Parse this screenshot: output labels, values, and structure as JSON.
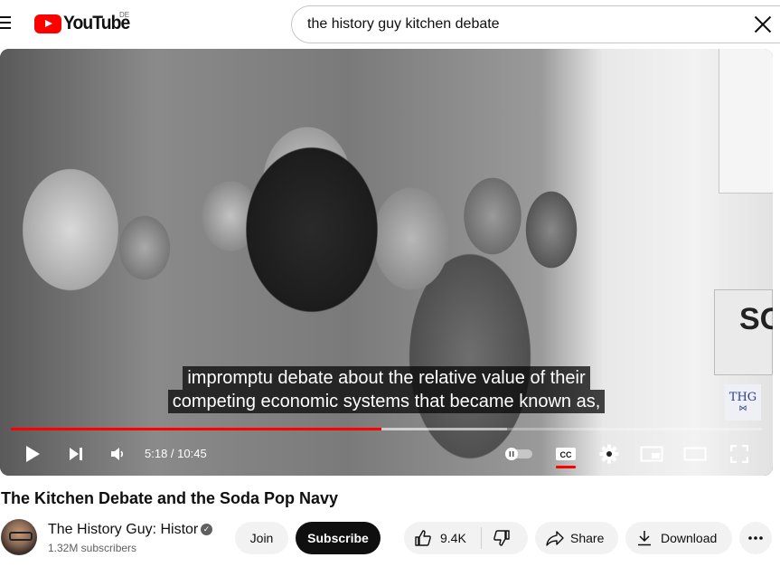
{
  "header": {
    "logo_text": "YouTube",
    "country_code": "DE",
    "search_value": "the history guy kitchen debate"
  },
  "player": {
    "caption_lines": [
      "impromptu debate about the relative value of their",
      "competing economic systems that became known as,"
    ],
    "watermark": "THG",
    "scene_text": "SO",
    "time_current": "5:18",
    "time_separator": " / ",
    "time_total": "10:45",
    "progress_played_fraction": 0.493,
    "progress_buffered_fraction": 0.661,
    "cc_enabled": true,
    "accent_color": "#ff0000"
  },
  "video": {
    "title": "The Kitchen Debate and the Soda Pop Navy",
    "channel_name": "The History Guy: Histor",
    "subscribers": "1.32M subscribers",
    "join_label": "Join",
    "subscribe_label": "Subscribe",
    "like_count": "9.4K",
    "share_label": "Share",
    "download_label": "Download"
  },
  "icons": {
    "menu": "menu-icon",
    "search_clear": "close-icon",
    "play": "play-icon",
    "next": "next-icon",
    "volume": "volume-icon",
    "autoplay": "autoplay-toggle-icon",
    "captions": "cc-icon",
    "settings": "gear-icon",
    "miniplayer": "miniplayer-icon",
    "theater": "theater-icon",
    "fullscreen": "fullscreen-icon",
    "like": "thumbs-up-icon",
    "dislike": "thumbs-down-icon",
    "share": "share-icon",
    "download": "download-icon",
    "more": "more-icon",
    "verified": "verified-icon"
  }
}
